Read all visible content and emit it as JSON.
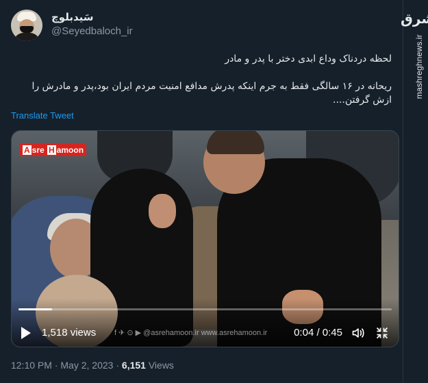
{
  "watermark": {
    "url": "mashreghnews.ir",
    "logo": "مشرق",
    "logo_icon": "mashregh-logo"
  },
  "author": {
    "name": "سَیدبلوچ",
    "handle": "@Seyedbaloch_ir",
    "avatar_icon": "profile-avatar"
  },
  "tweet": {
    "line1": "لحظه دردناک وداع ابدی دختر با پدر و مادر",
    "line2": "ریحانه در ۱۶ سالگی فقط به جرم اینکه پدرش مدافع امنیت مردم ایران بود،پدر و مادرش را ازش گرفتن....",
    "translate_label": "Translate Tweet"
  },
  "video": {
    "brand_pre": "A",
    "brand_mid1": "sre ",
    "brand_h": "H",
    "brand_post": "amoon",
    "bottom_watermark": "f  ✈  ⊙  ▶  @asrehamoon.ir     www.asrehamoon.ir",
    "views": "1,518 views",
    "time": "0:04 / 0:45",
    "progress": 0.09,
    "icons": [
      "play-icon",
      "volume-icon",
      "fullscreen-icon"
    ]
  },
  "meta": {
    "time": "12:10 PM",
    "sep1": " · ",
    "date": "May 2, 2023",
    "sep2": " · ",
    "views_count": "6,151",
    "views_label": " Views"
  },
  "colors": {
    "background": "#15202b",
    "link": "#1d9bf0",
    "muted": "#8b98a5",
    "text": "#e7e9ea",
    "brand_red": "#d6251f"
  }
}
